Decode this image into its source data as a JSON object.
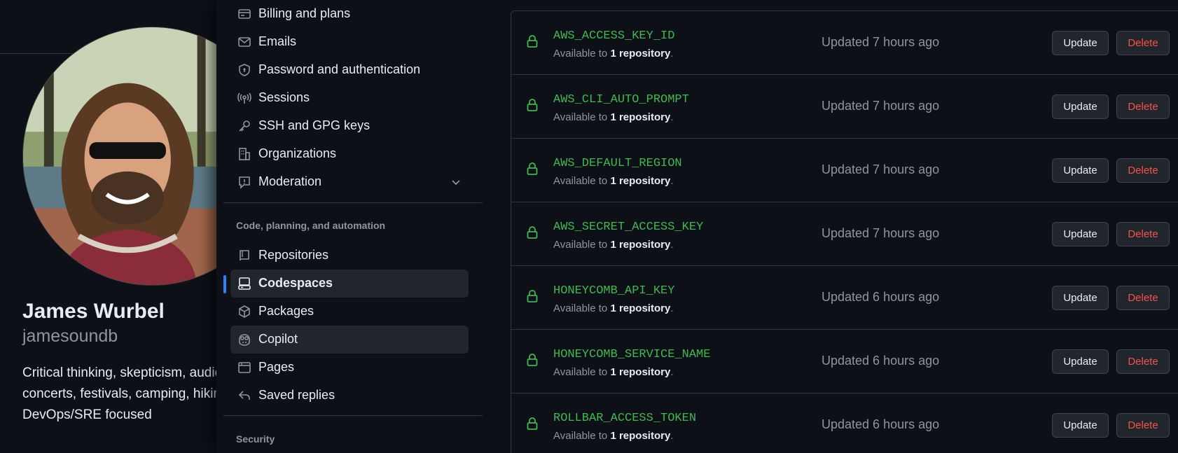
{
  "profile": {
    "name": "James Wurbel",
    "login": "jamesoundb",
    "bio": "Critical thinking, skepticism, audio engineer, Star Wars, concerts, festivals, camping, hiking, outdoors, good beer. DevOps/SRE focused"
  },
  "nav": {
    "items": [
      {
        "label": "Billing and plans",
        "icon": "credit-card-icon"
      },
      {
        "label": "Emails",
        "icon": "mail-icon"
      },
      {
        "label": "Password and authentication",
        "icon": "shield-lock-icon"
      },
      {
        "label": "Sessions",
        "icon": "broadcast-icon"
      },
      {
        "label": "SSH and GPG keys",
        "icon": "key-icon"
      },
      {
        "label": "Organizations",
        "icon": "organization-icon"
      },
      {
        "label": "Moderation",
        "icon": "report-icon"
      }
    ],
    "section_code": "Code, planning, and automation",
    "code_items": [
      {
        "label": "Repositories",
        "icon": "repo-icon"
      },
      {
        "label": "Codespaces",
        "icon": "codespaces-icon"
      },
      {
        "label": "Packages",
        "icon": "package-icon"
      },
      {
        "label": "Copilot",
        "icon": "copilot-icon"
      },
      {
        "label": "Pages",
        "icon": "browser-icon"
      },
      {
        "label": "Saved replies",
        "icon": "reply-icon"
      }
    ],
    "section_security": "Security",
    "active": "Codespaces"
  },
  "secrets": {
    "available_prefix": "Available to ",
    "available_scope": "1 repository",
    "available_suffix": ".",
    "update_label": "Update",
    "delete_label": "Delete",
    "rows": [
      {
        "name": "AWS_ACCESS_KEY_ID",
        "updated": "Updated 7 hours ago"
      },
      {
        "name": "AWS_CLI_AUTO_PROMPT",
        "updated": "Updated 7 hours ago"
      },
      {
        "name": "AWS_DEFAULT_REGION",
        "updated": "Updated 7 hours ago"
      },
      {
        "name": "AWS_SECRET_ACCESS_KEY",
        "updated": "Updated 7 hours ago"
      },
      {
        "name": "HONEYCOMB_API_KEY",
        "updated": "Updated 6 hours ago"
      },
      {
        "name": "HONEYCOMB_SERVICE_NAME",
        "updated": "Updated 6 hours ago"
      },
      {
        "name": "ROLLBAR_ACCESS_TOKEN",
        "updated": "Updated 6 hours ago"
      }
    ]
  },
  "colors": {
    "background": "#0d1117",
    "accent_blue": "#2f81f7",
    "secret_green": "#3fb950",
    "danger_red": "#f85149",
    "border": "#30363d"
  }
}
